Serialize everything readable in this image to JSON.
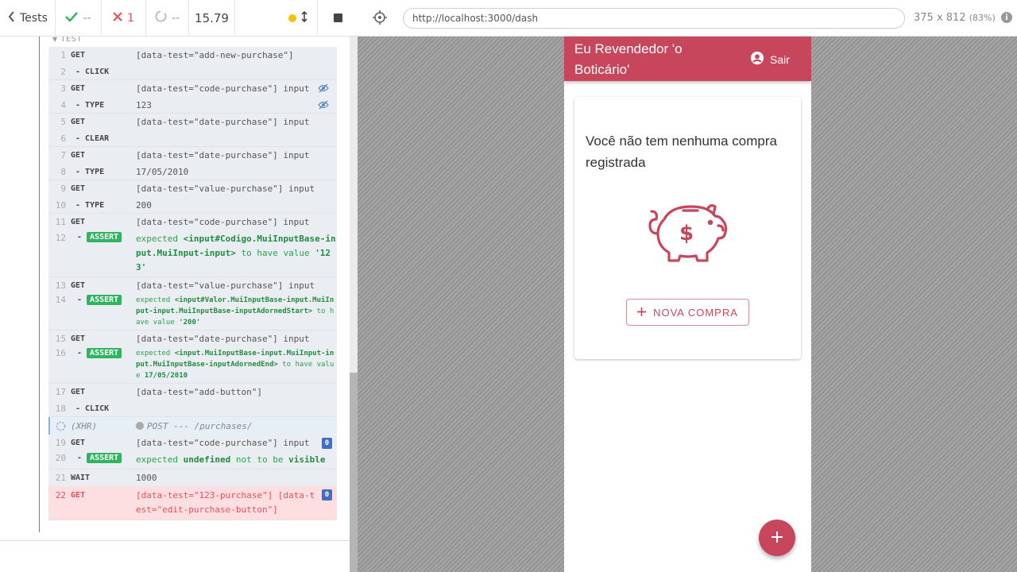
{
  "reporter": {
    "header": {
      "tests_label": "Tests",
      "passed": "--",
      "failed": "1",
      "pending": "--",
      "duration": "15.79"
    },
    "test_title": "TEST",
    "commands": [
      {
        "num": "1",
        "name": "GET",
        "msg": "[data-test=\"add-new-purchase\"]"
      },
      {
        "num": "2",
        "name": "- CLICK",
        "msg": ""
      },
      {
        "num": "3",
        "name": "GET",
        "msg": "[data-test=\"code-purchase\"] input"
      },
      {
        "num": "4",
        "name": "- TYPE",
        "msg": "123"
      },
      {
        "num": "5",
        "name": "GET",
        "msg": "[data-test=\"date-purchase\"] input"
      },
      {
        "num": "6",
        "name": "- CLEAR",
        "msg": ""
      },
      {
        "num": "7",
        "name": "GET",
        "msg": "[data-test=\"date-purchase\"] input"
      },
      {
        "num": "8",
        "name": "- TYPE",
        "msg": "17/05/2010"
      },
      {
        "num": "9",
        "name": "GET",
        "msg": "[data-test=\"value-purchase\"] input"
      },
      {
        "num": "10",
        "name": "- TYPE",
        "msg": "200"
      },
      {
        "num": "11",
        "name": "GET",
        "msg": "[data-test=\"code-purchase\"] input"
      },
      {
        "num": "12",
        "name": "ASSERT",
        "expected": "expected",
        "subject": "<input#Codigo.MuiInputBase-input.MuiInput-input>",
        "verb": "to have value",
        "value": "'123'"
      },
      {
        "num": "13",
        "name": "GET",
        "msg": "[data-test=\"value-purchase\"] input"
      },
      {
        "num": "14",
        "name": "ASSERT",
        "expected": "expected",
        "subject": "<input#Valor.MuiInputBase-input.MuiInput-input.MuiInputBase-inputAdornedStart>",
        "verb": "to have value",
        "value": "'200'"
      },
      {
        "num": "15",
        "name": "GET",
        "msg": "[data-test=\"date-purchase\"] input"
      },
      {
        "num": "16",
        "name": "ASSERT",
        "expected": "expected",
        "subject": "<input.MuiInputBase-input.MuiInput-input.MuiInputBase-inputAdornedEnd>",
        "verb": "to have value",
        "value": "17/05/2010"
      },
      {
        "num": "17",
        "name": "GET",
        "msg": "[data-test=\"add-button\"]"
      },
      {
        "num": "18",
        "name": "- CLICK",
        "msg": ""
      },
      {
        "num": "",
        "name": "(XHR)",
        "msg": "POST --- /purchases/"
      },
      {
        "num": "19",
        "name": "GET",
        "msg": "[data-test=\"code-purchase\"] input",
        "badge": "0"
      },
      {
        "num": "20",
        "name": "ASSERT",
        "expected": "expected",
        "subject": "undefined",
        "verb": "not to be",
        "value": "visible"
      },
      {
        "num": "21",
        "name": "WAIT",
        "msg": "1000"
      },
      {
        "num": "22",
        "name": "GET",
        "msg": "[data-test=\"123-purchase\"] [data-test=\"edit-purchase-button\"]",
        "badge": "0"
      }
    ]
  },
  "aut": {
    "url": "http://localhost:3000/dash",
    "viewport": "375 x 812",
    "scale": "(83%)"
  },
  "app": {
    "title": "Eu Revendedor 'o Boticário'",
    "logout_label": "Sair",
    "empty_message": "Você não tem nenhuma compra registrada",
    "new_purchase_label": "NOVA COMPRA"
  },
  "colors": {
    "brand": "#c8465c",
    "pass": "#2fb55f",
    "fail": "#e94f5b"
  }
}
